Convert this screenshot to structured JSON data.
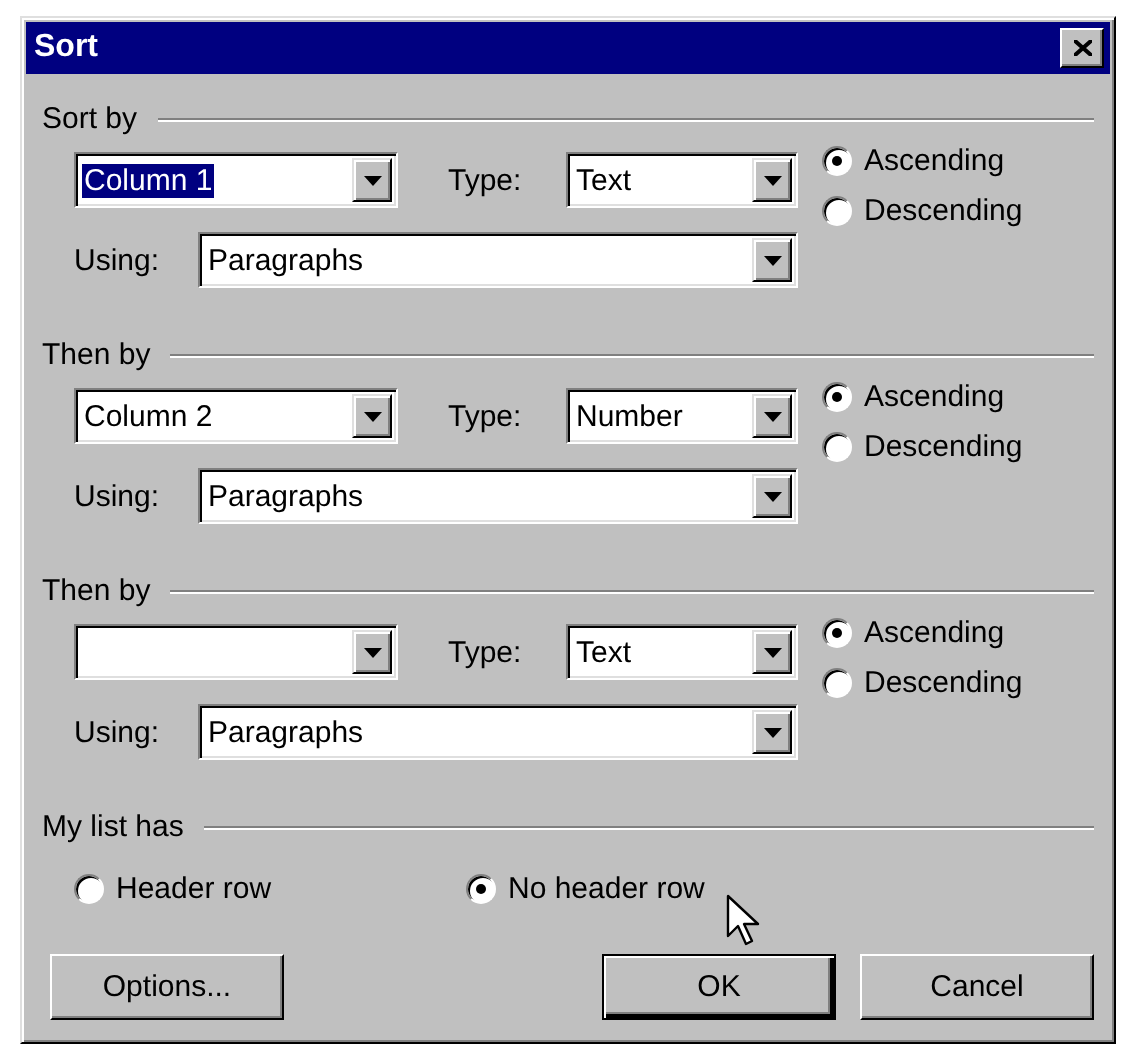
{
  "window": {
    "title": "Sort"
  },
  "sections": [
    {
      "heading": "Sort by",
      "column": {
        "value": "Column 1",
        "highlighted": true
      },
      "type_label": "Type:",
      "type": {
        "value": "Text"
      },
      "using_label": "Using:",
      "using": {
        "value": "Paragraphs"
      },
      "order": [
        {
          "label": "Ascending",
          "selected": true
        },
        {
          "label": "Descending",
          "selected": false
        }
      ]
    },
    {
      "heading": "Then by",
      "column": {
        "value": "Column 2",
        "highlighted": false
      },
      "type_label": "Type:",
      "type": {
        "value": "Number"
      },
      "using_label": "Using:",
      "using": {
        "value": "Paragraphs"
      },
      "order": [
        {
          "label": "Ascending",
          "selected": true
        },
        {
          "label": "Descending",
          "selected": false
        }
      ]
    },
    {
      "heading": "Then by",
      "type_label": "Type:",
      "type": {
        "value": "Text"
      },
      "using_label": "Using:",
      "using": {
        "value": "Paragraphs"
      },
      "order": [
        {
          "label": "Ascending",
          "selected": true
        },
        {
          "label": "Descending",
          "selected": false
        }
      ]
    }
  ],
  "list_has": {
    "heading": "My list has",
    "options": [
      {
        "label": "Header row",
        "selected": false
      },
      {
        "label": "No header row",
        "selected": true
      }
    ]
  },
  "buttons": [
    {
      "label": "Options...",
      "default": false
    },
    {
      "label": "OK",
      "default": true
    },
    {
      "label": "Cancel",
      "default": false
    }
  ]
}
